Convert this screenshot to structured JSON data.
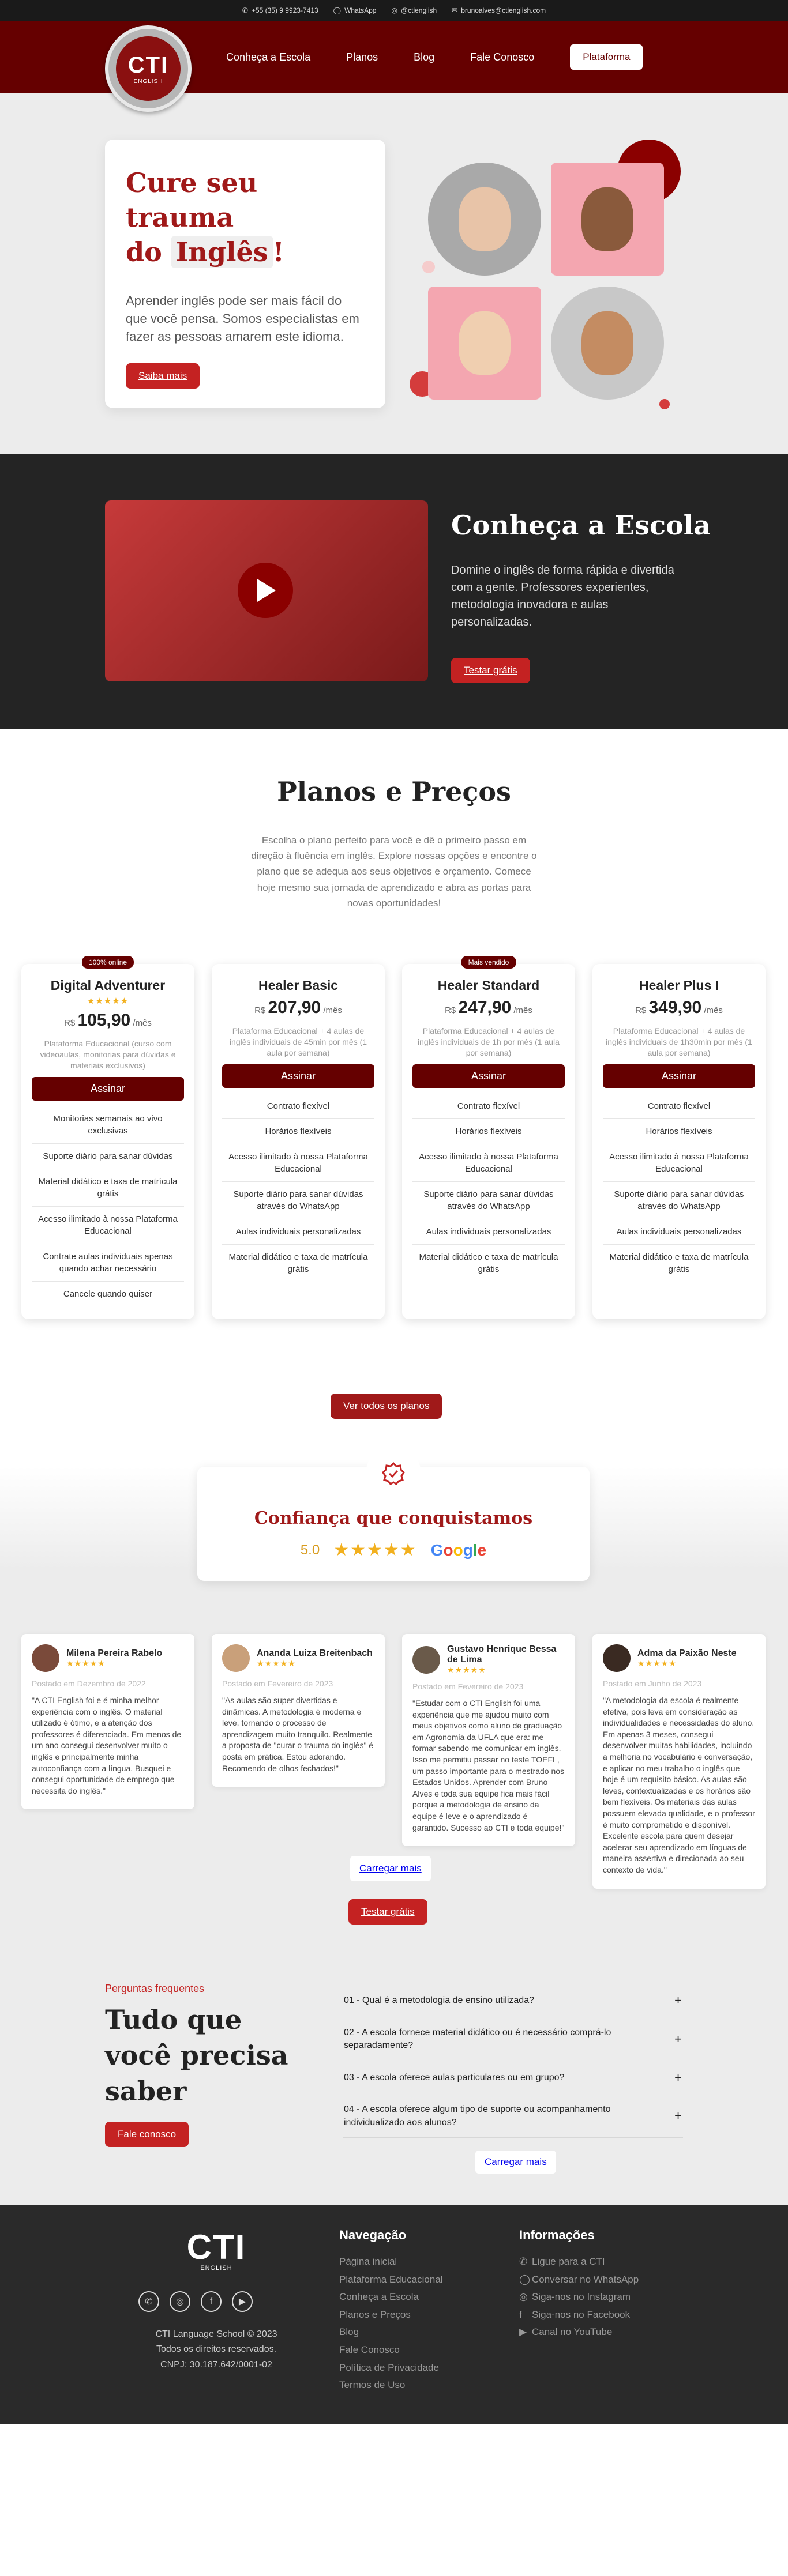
{
  "topbar": {
    "phone": "+55 (35) 9 9923-7413",
    "whatsapp": "WhatsApp",
    "instagram": "@ctienglish",
    "email": "brunoalves@ctienglish.com"
  },
  "logo": {
    "text": "CTI",
    "sub": "ENGLISH"
  },
  "nav": {
    "items": [
      "Conheça a Escola",
      "Planos",
      "Blog",
      "Fale Conosco"
    ],
    "platform": "Plataforma"
  },
  "hero": {
    "title_line1": "Cure seu trauma",
    "title_pre": "do ",
    "title_hl": "Inglês",
    "title_post": "!",
    "text": "Aprender inglês pode ser mais fácil do que você pensa. Somos especialistas em fazer as pessoas amarem este idioma.",
    "cta": "Saiba mais"
  },
  "school": {
    "title": "Conheça a Escola",
    "text": "Domine o inglês de forma rápida e divertida com a gente. Professores experientes, metodologia inovadora e aulas personalizadas.",
    "cta": "Testar grátis"
  },
  "plans": {
    "title": "Planos e Preços",
    "subtitle": "Escolha o plano perfeito para você e dê o primeiro passo em direção à fluência em inglês. Explore nossas opções e encontre o plano que se adequa aos seus objetivos e orçamento. Comece hoje mesmo sua jornada de aprendizado e abra as portas para novas oportunidades!",
    "currency": "R$",
    "period": "/mês",
    "sign": "Assinar",
    "all": "Ver todos os planos",
    "items": [
      {
        "badge": "100% online",
        "name": "Digital Adventurer",
        "stars": "★★★★★",
        "price": "105,90",
        "desc": "Plataforma Educacional (curso com videoaulas, monitorias para dúvidas e materiais exclusivos)",
        "features": [
          "Monitorias semanais ao vivo exclusivas",
          "Suporte diário para sanar dúvidas",
          "Material didático e taxa de matrícula grátis",
          "Acesso ilimitado à nossa Plataforma Educacional",
          "Contrate aulas individuais apenas quando achar necessário",
          "Cancele quando quiser"
        ]
      },
      {
        "badge": "",
        "name": "Healer Basic",
        "stars": "",
        "price": "207,90",
        "desc": "Plataforma Educacional + 4 aulas de inglês individuais de 45min por mês (1 aula por semana)",
        "features": [
          "Contrato flexível",
          "Horários flexíveis",
          "Acesso ilimitado à nossa Plataforma Educacional",
          "Suporte diário para sanar dúvidas através do WhatsApp",
          "Aulas individuais personalizadas",
          "Material didático e taxa de matrícula grátis"
        ]
      },
      {
        "badge": "Mais vendido",
        "name": "Healer Standard",
        "stars": "",
        "price": "247,90",
        "desc": "Plataforma Educacional + 4 aulas de inglês individuais de 1h por mês (1 aula por semana)",
        "features": [
          "Contrato flexível",
          "Horários flexíveis",
          "Acesso ilimitado à nossa Plataforma Educacional",
          "Suporte diário para sanar dúvidas através do WhatsApp",
          "Aulas individuais personalizadas",
          "Material didático e taxa de matrícula grátis"
        ]
      },
      {
        "badge": "",
        "name": "Healer Plus I",
        "stars": "",
        "price": "349,90",
        "desc": "Plataforma Educacional + 4 aulas de inglês individuais de 1h30min por mês (1 aula por semana)",
        "features": [
          "Contrato flexível",
          "Horários flexíveis",
          "Acesso ilimitado à nossa Plataforma Educacional",
          "Suporte diário para sanar dúvidas através do WhatsApp",
          "Aulas individuais personalizadas",
          "Material didático e taxa de matrícula grátis"
        ]
      }
    ]
  },
  "trust": {
    "title": "Confiança que conquistamos",
    "score": "5.0",
    "stars": "★★★★★",
    "google": "Google"
  },
  "reviews": [
    {
      "name": "Milena Pereira Rabelo",
      "stars": "★★★★★",
      "date": "Postado em Dezembro de 2022",
      "text": "\"A CTI English foi e é minha melhor experiência com o inglês. O material utilizado é ótimo, e a atenção dos professores é diferenciada. Em menos de um ano consegui desenvolver muito o inglês e principalmente minha autoconfiança com a língua. Busquei e consegui oportunidade de emprego que necessita do inglês.\""
    },
    {
      "name": "Ananda Luiza Breitenbach",
      "stars": "★★★★★",
      "date": "Postado em Fevereiro de 2023",
      "text": "\"As aulas são super divertidas e dinâmicas. A metodologia é moderna e leve, tornando o processo de aprendizagem muito tranquilo. Realmente a proposta de \"curar o trauma do inglês\" é posta em prática. Estou adorando. Recomendo de olhos fechados!\""
    },
    {
      "name": "Gustavo Henrique Bessa de Lima",
      "stars": "★★★★★",
      "date": "Postado em Fevereiro de 2023",
      "text": "\"Estudar com o CTI English foi uma experiência que me ajudou muito com meus objetivos como aluno de graduação em Agronomia da UFLA que era: me formar sabendo me comunicar em inglês. Isso me permitiu passar no teste TOEFL, um passo importante para o mestrado nos Estados Unidos. Aprender com Bruno Alves e toda sua equipe fica mais fácil porque a metodologia de ensino da equipe é leve e o aprendizado é garantido. Sucesso ao CTI e toda equipe!\""
    },
    {
      "name": "Adma da Paixão Neste",
      "stars": "★★★★★",
      "date": "Postado em Junho de 2023",
      "text": "\"A metodologia da escola é realmente efetiva, pois leva em consideração as individualidades e necessidades do aluno. Em apenas 3 meses, consegui desenvolver muitas habilidades, incluindo a melhoria no vocabulário e conversação, e aplicar no meu trabalho o inglês que hoje é um requisito básico. As aulas são leves, contextualizadas e os horários são bem flexíveis. Os materiais das aulas possuem elevada qualidade, e o professor é muito comprometido e disponível. Excelente escola para quem desejar acelerar seu aprendizado em línguas de maneira assertiva e direcionada ao seu contexto de vida.\""
    }
  ],
  "reviews_more": "Carregar mais",
  "reviews_cta": "Testar grátis",
  "faq": {
    "kicker": "Perguntas frequentes",
    "title": "Tudo que você precisa saber",
    "cta": "Fale conosco",
    "items": [
      "01 - Qual é a metodologia de ensino utilizada?",
      "02 - A escola fornece material didático ou é necessário comprá-lo separadamente?",
      "03 - A escola oferece aulas particulares ou em grupo?",
      "04 - A escola oferece algum tipo de suporte ou acompanhamento individualizado aos alunos?"
    ],
    "more": "Carregar mais"
  },
  "footer": {
    "logo": "CTI",
    "logo_sub": "ENGLISH",
    "copy": [
      "CTI Language School © 2023",
      "Todos os direitos reservados.",
      "CNPJ: 30.187.642/0001-02"
    ],
    "nav_title": "Navegação",
    "nav": [
      "Página inicial",
      "Plataforma Educacional",
      "Conheça a Escola",
      "Planos e Preços",
      "Blog",
      "Fale Conosco",
      "Política de Privacidade",
      "Termos de Uso"
    ],
    "info_title": "Informações",
    "info": [
      "Ligue para a CTI",
      "Conversar no WhatsApp",
      "Siga-nos no Instagram",
      "Siga-nos no Facebook",
      "Canal no YouTube"
    ]
  },
  "colors": {
    "brand": "#650000",
    "accent": "#c42222",
    "title_red": "#a01919",
    "star": "#f2b01e"
  }
}
